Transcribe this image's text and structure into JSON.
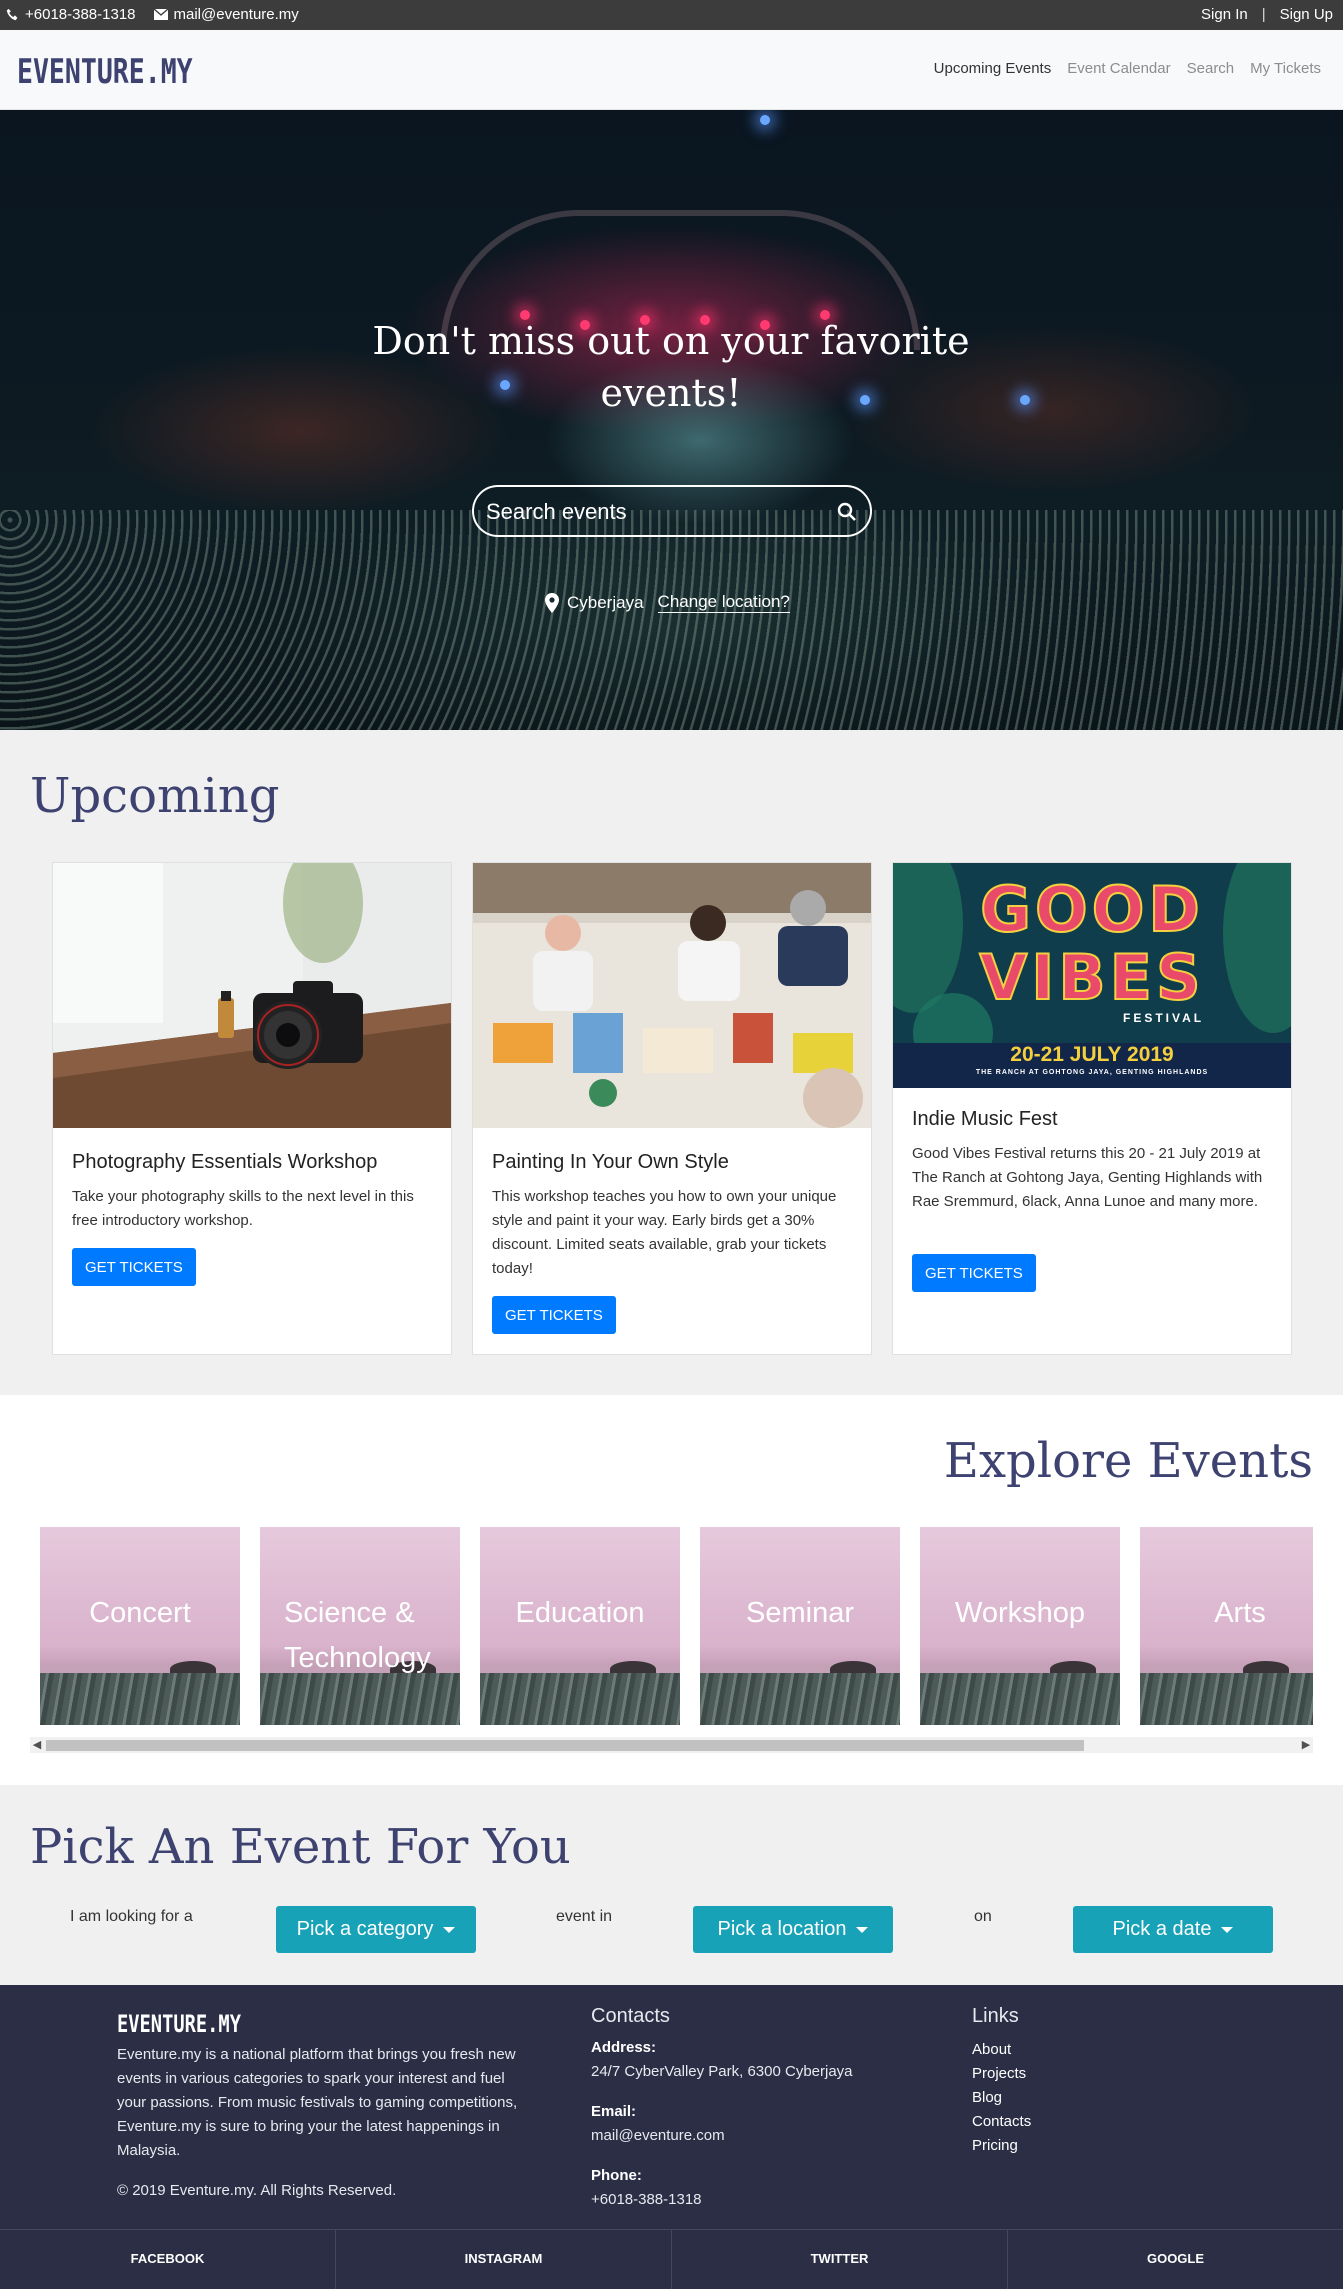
{
  "topbar": {
    "phone": "+6018-388-1318",
    "email": "mail@eventure.my",
    "sign_in": "Sign In",
    "separator": "|",
    "sign_up": "Sign Up"
  },
  "nav": {
    "logo": "EVENTURE.MY",
    "links": [
      "Upcoming Events",
      "Event Calendar",
      "Search",
      "My Tickets"
    ],
    "active": "Upcoming Events"
  },
  "hero": {
    "title": "Don't miss out on your favorite events!",
    "search_placeholder": "Search events",
    "location": "Cyberjaya",
    "change_location": "Change location?"
  },
  "upcoming": {
    "title": "Upcoming",
    "cards": [
      {
        "title": "Photography Essentials Workshop",
        "text": "Take your photography skills to the next level in this free introductory workshop.",
        "button": "GET TICKETS"
      },
      {
        "title": "Painting In Your Own Style",
        "text": "This workshop teaches you how to own your unique style and paint it your way. Early birds get a 30% discount. Limited seats available, grab your tickets today!",
        "button": "GET TICKETS"
      },
      {
        "title": "Indie Music Fest",
        "text": "Good Vibes Festival returns this 20 - 21 July 2019 at The Ranch at Gohtong Jaya, Genting Highlands with Rae Sremmurd, 6lack, Anna Lunoe and many more.",
        "button": "GET TICKETS",
        "poster": {
          "line1": "GOOD",
          "line2": "VIBES",
          "line3": "FESTIVAL",
          "dates": "20-21 JULY 2019",
          "venue": "THE RANCH AT GOHTONG JAYA, GENTING HIGHLANDS"
        }
      }
    ]
  },
  "explore": {
    "title": "Explore Events",
    "categories": [
      {
        "line1": "Concert",
        "line2": ""
      },
      {
        "line1": "Science &",
        "line2": "Technology"
      },
      {
        "line1": "Education",
        "line2": ""
      },
      {
        "line1": "Seminar",
        "line2": ""
      },
      {
        "line1": "Workshop",
        "line2": ""
      },
      {
        "line1": "Arts",
        "line2": ""
      }
    ],
    "scroll_position": 0.0
  },
  "pick": {
    "title": "Pick An Event For You",
    "text1": "I am looking for a",
    "category_btn": "Pick a category",
    "text2": "event in",
    "location_btn": "Pick a location",
    "text3": "on",
    "date_btn": "Pick a date"
  },
  "footer": {
    "logo": "EVENTURE.MY",
    "about": "Eventure.my is a national platform that brings you fresh new events in various categories to spark your interest and fuel your passions. From music festivals to gaming competitions, Eventure.my is sure to bring your the latest happenings in Malaysia.",
    "copyright": "© 2019 Eventure.my. All Rights Reserved.",
    "contacts_heading": "Contacts",
    "address_label": "Address:",
    "address": "24/7 CyberValley Park, 6300 Cyberjaya",
    "email_label": "Email:",
    "email": "mail@eventure.com",
    "phone_label": "Phone:",
    "phone": "+6018-388-1318",
    "links_heading": "Links",
    "links": [
      "About",
      "Projects",
      "Blog",
      "Contacts",
      "Pricing"
    ]
  },
  "social": [
    "FACEBOOK",
    "INSTAGRAM",
    "TWITTER",
    "GOOGLE"
  ],
  "colors": {
    "brand": "#3d4270",
    "primary_button": "#007bff",
    "pick_button": "#17a2b8",
    "footer_bg": "#2b2e45"
  }
}
